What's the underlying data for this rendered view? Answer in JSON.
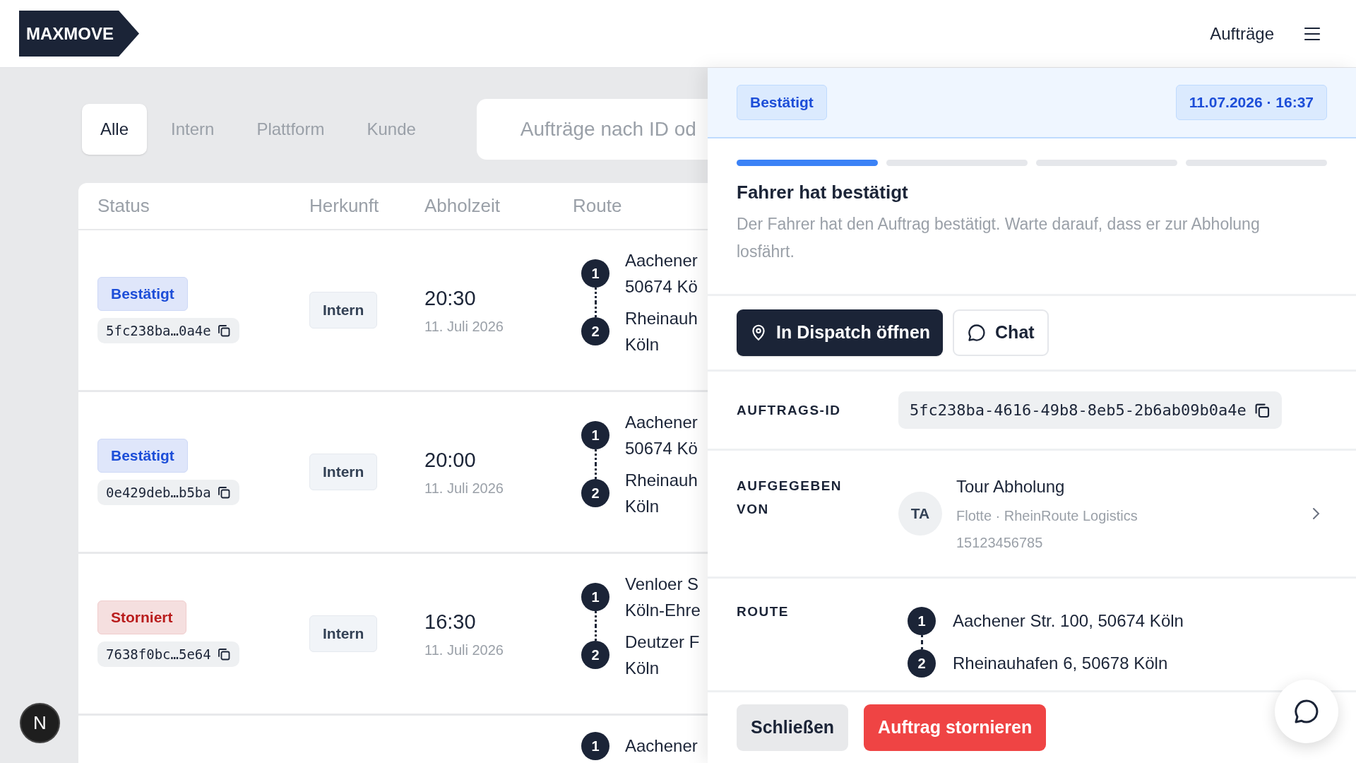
{
  "header": {
    "logo": "MAXMOVE",
    "nav_link": "Aufträge"
  },
  "filter_tabs": [
    {
      "label": "Alle",
      "selected": true
    },
    {
      "label": "Intern",
      "selected": false
    },
    {
      "label": "Plattform",
      "selected": false
    },
    {
      "label": "Kunde",
      "selected": false
    }
  ],
  "search": {
    "placeholder": "Aufträge nach ID od"
  },
  "table": {
    "columns": [
      "Status",
      "Herkunft",
      "Abholzeit",
      "Route"
    ],
    "rows": [
      {
        "status": "Bestätigt",
        "color": "#1d4ed8",
        "id": "5fc238ba…0a4e",
        "origin": "Intern",
        "time": "20:30",
        "date": "11. Juli 2026",
        "stops": [
          {
            "number": "1",
            "lines": [
              "Aachener",
              "50674 Kö"
            ]
          },
          {
            "number": "2",
            "lines": [
              "Rheinauh",
              "Köln"
            ]
          }
        ]
      },
      {
        "status": "Bestätigt",
        "color": "#1d4ed8",
        "id": "0e429deb…b5ba",
        "origin": "Intern",
        "time": "20:00",
        "date": "11. Juli 2026",
        "stops": [
          {
            "number": "1",
            "lines": [
              "Aachener",
              "50674 Kö"
            ]
          },
          {
            "number": "2",
            "lines": [
              "Rheinauh",
              "Köln"
            ]
          }
        ]
      },
      {
        "status": "Storniert",
        "color": "#b91c1c",
        "id": "7638f0bc…5e64",
        "origin": "Intern",
        "time": "16:30",
        "date": "11. Juli 2026",
        "stops": [
          {
            "number": "1",
            "lines": [
              "Venloer S",
              "Köln-Ehre"
            ]
          },
          {
            "number": "2",
            "lines": [
              "Deutzer F",
              "Köln"
            ]
          }
        ]
      },
      {
        "stops": [
          {
            "number": "1",
            "lines": [
              "Aachener"
            ]
          }
        ]
      }
    ]
  },
  "dev_badge": {
    "label": "N"
  },
  "detail_panel": {
    "status_badge": "Bestätigt",
    "timestamp": "11.07.2026 · 16:37",
    "progress_steps": [
      {
        "active": true
      },
      {
        "active": false
      },
      {
        "active": false
      },
      {
        "active": false
      }
    ],
    "status_title": "Fahrer hat bestätigt",
    "status_description": "Der Fahrer hat den Auftrag bestätigt. Warte darauf, dass er zur Abholung losfährt.",
    "actions": [
      {
        "label": "In Dispatch öffnen",
        "kind": "primary"
      },
      {
        "label": "Chat",
        "kind": "secondary"
      }
    ],
    "order_id": {
      "label": "AUFTRAGS-ID",
      "value": "5fc238ba-4616-49b8-8eb5-2b6ab09b0a4e"
    },
    "placed_by": {
      "label": "AUFGEGEBEN VON",
      "initials": "TA",
      "name": "Tour Abholung",
      "subtitle": "Flotte · RheinRoute Logistics",
      "phone": "15123456785"
    },
    "route": {
      "label": "ROUTE",
      "stops": [
        {
          "number": "1",
          "address": "Aachener Str. 100, 50674 Köln"
        },
        {
          "number": "2",
          "address": "Rheinauhafen 6, 50678 Köln"
        }
      ]
    },
    "footer_buttons": [
      {
        "label": "Schließen",
        "kind": "secondary"
      },
      {
        "label": "Auftrag stornieren",
        "kind": "danger"
      }
    ]
  }
}
